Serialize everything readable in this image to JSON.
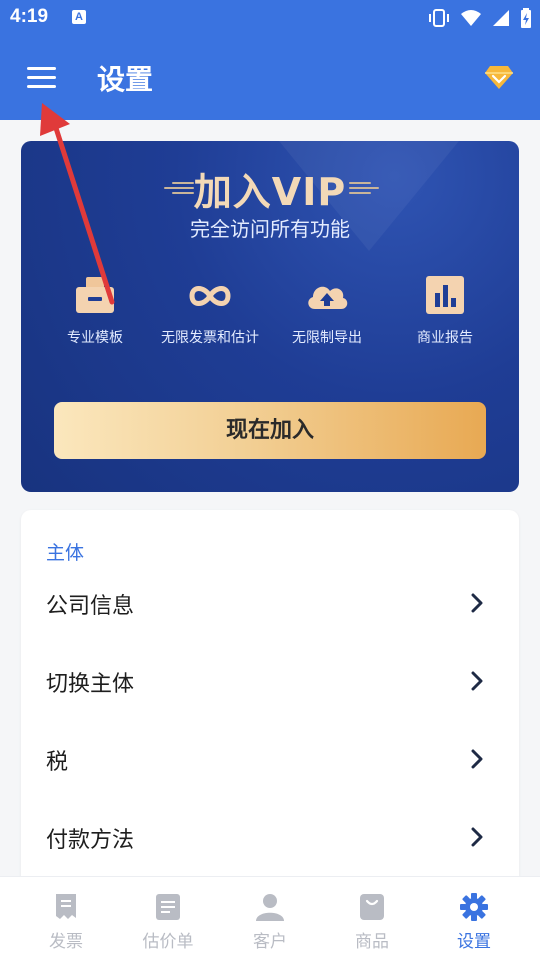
{
  "status_bar": {
    "time": "4:19",
    "notification_icon": "text-a-icon",
    "icons": [
      "vibrate-icon",
      "wifi-icon",
      "signal-icon",
      "battery-icon"
    ]
  },
  "app_bar": {
    "title": "设置",
    "menu_icon": "hamburger-menu-icon",
    "action_icon": "vip-diamond-icon"
  },
  "vip_card": {
    "title": "加入VIP",
    "subtitle": "完全访问所有功能",
    "features": [
      {
        "label": "专业模板",
        "icon": "template-icon"
      },
      {
        "label": "无限发票和估计",
        "icon": "infinity-icon"
      },
      {
        "label": "无限制导出",
        "icon": "cloud-upload-icon"
      },
      {
        "label": "商业报告",
        "icon": "bar-chart-icon"
      }
    ],
    "join_button": "现在加入"
  },
  "settings": {
    "section_title": "主体",
    "items": [
      {
        "label": "公司信息"
      },
      {
        "label": "切换主体"
      },
      {
        "label": "税"
      },
      {
        "label": "付款方法"
      }
    ]
  },
  "bottom_nav": {
    "items": [
      {
        "label": "发票",
        "icon": "invoice-icon",
        "active": false
      },
      {
        "label": "估价单",
        "icon": "estimate-icon",
        "active": false
      },
      {
        "label": "客户",
        "icon": "customer-icon",
        "active": false
      },
      {
        "label": "商品",
        "icon": "product-icon",
        "active": false
      },
      {
        "label": "设置",
        "icon": "settings-gear-icon",
        "active": true
      }
    ]
  },
  "colors": {
    "primary": "#3a73e0",
    "vip_dark": "#1f3d95",
    "gold": "#f3d9b7",
    "annotation_arrow": "#e03a3a"
  }
}
